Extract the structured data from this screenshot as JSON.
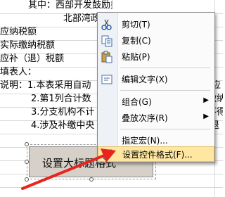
{
  "sheet": {
    "rows": [
      {
        "text": "其中：西部开发鼓励类减免",
        "indent": "deep"
      },
      {
        "text": "北部湾政策减免",
        "indent": "deeper"
      },
      {
        "text": "应纳税额",
        "indent": "none"
      },
      {
        "text": "实际缴纳税额",
        "indent": "none"
      },
      {
        "text": "应补（退）税额",
        "indent": "none"
      },
      {
        "text": "填表人：",
        "indent": "none"
      },
      {
        "text": "说明：1.本表采用自动",
        "indent": "none"
      },
      {
        "text": "2.第1列合计数",
        "indent": "mid"
      },
      {
        "text": "3.分支机构不计",
        "indent": "mid"
      },
      {
        "text": "4.涉及补缴中央",
        "indent": "mid"
      }
    ],
    "right_fragments": [
      "\"应",
      "缴纳",
      "不得",
      "退"
    ]
  },
  "form_button": {
    "label": "设置大标题格式"
  },
  "context_menu": {
    "items": [
      {
        "label": "剪切(T)",
        "icon": "scissors-icon",
        "sep_before": false
      },
      {
        "label": "复制(C)",
        "icon": "copy-icon",
        "sep_before": false
      },
      {
        "label": "粘贴(P)",
        "icon": "paste-icon",
        "sep_before": false
      },
      {
        "label": "编辑文字(X)",
        "icon": "edit-text-icon",
        "sep_before": true
      },
      {
        "label": "组合(G)",
        "icon": "",
        "submenu": true,
        "sep_before": true
      },
      {
        "label": "叠放次序(R)",
        "icon": "",
        "submenu": true,
        "sep_before": false
      },
      {
        "label": "指定宏(N)...",
        "icon": "",
        "sep_before": true
      },
      {
        "label": "设置控件格式(F)...",
        "icon": "format-control-icon",
        "sep_before": false,
        "highlighted": true
      }
    ]
  },
  "colors": {
    "highlight": "#ffe7a2",
    "arrow": "#e8251c",
    "button_face": "#d6d0c8"
  }
}
